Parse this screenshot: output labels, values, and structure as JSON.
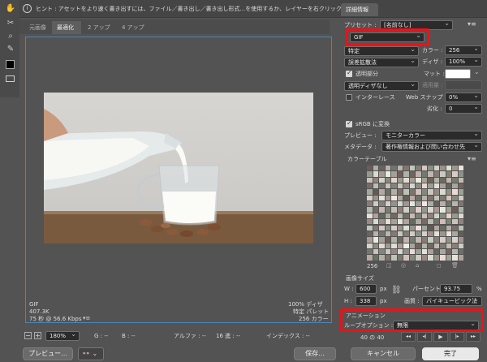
{
  "hint": "ヒント : アセットをより速く書き出すには、ファイル／書き出し／書き出し形式...を使用するか、レイヤーを右クリックして使用。",
  "tabs": [
    "元画像",
    "最適化",
    "2 アップ",
    "4 アップ"
  ],
  "info_bottom": {
    "format": "GIF",
    "size": "407.3K",
    "time": "75 秒 @ 56.6 Kbps",
    "dither": "100% ディザ",
    "palette": "特定 パレット",
    "colors_count": "256 カラー"
  },
  "status": {
    "zoom": "180%",
    "g": "G : --",
    "b": "B : --",
    "alpha": "アルファ : --",
    "hex": "16 進 : --",
    "index": "インデックス : --"
  },
  "footer": {
    "preview": "プレビュー...",
    "save": "保存...",
    "cancel": "キャンセル",
    "done": "完了"
  },
  "panel": {
    "tab": "詳細情報",
    "preset_label": "プリセット :",
    "preset_value": "[名前なし]",
    "format": "GIF",
    "palette": "特定",
    "colors_label": "カラー :",
    "colors_value": "256",
    "dither_algo": "誤差拡散法",
    "dither_label": "ディザ :",
    "dither_value": "100%",
    "transparency_label": "透明部分",
    "matte_label": "マット :",
    "transparency_dither": "透明ディザなし",
    "amount_label": "適用量 :",
    "interlace_label": "インターレース",
    "web_snap_label": "Web スナップ :",
    "web_snap_value": "0%",
    "lossy_label": "劣化 :",
    "lossy_value": "0",
    "srgb_label": "sRGB に変換",
    "preview_label": "プレビュー :",
    "preview_value": "モニターカラー",
    "metadata_label": "メタデータ :",
    "metadata_value": "著作権情報および問い合わせ先",
    "color_table_label": "カラーテーブル",
    "color_count": "256",
    "image_size_label": "画像サイズ",
    "w_label": "W :",
    "w_value": "600",
    "h_label": "H :",
    "h_value": "338",
    "px": "px",
    "percent_label": "パーセント :",
    "percent_value": "93.75",
    "percent_unit": "%",
    "quality_label": "画質 :",
    "quality_value": "バイキュービック法",
    "animation_label": "アニメーション",
    "loop_label": "ループオプション :",
    "loop_value": "無限",
    "frame_counter": "40 の 40"
  },
  "accent": "#e8141a"
}
